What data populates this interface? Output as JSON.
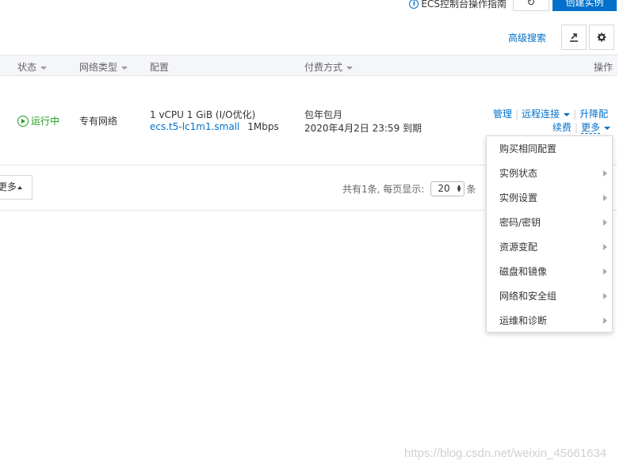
{
  "toolbar": {
    "guide_label": "ECS控制台操作指南",
    "create_label": "创建实例",
    "advanced_search": "高级搜索"
  },
  "table": {
    "headers": {
      "status": "状态",
      "network": "网络类型",
      "config": "配置",
      "billing": "付费方式",
      "actions": "操作"
    },
    "row": {
      "status": "运行中",
      "network": "专有网络",
      "config_line1": "1 vCPU 1 GiB (I/O优化)",
      "instance_type": "ecs.t5-lc1m1.small",
      "bandwidth": "1Mbps",
      "billing_line1": "包年包月",
      "billing_line2": "2020年4月2日 23:59 到期",
      "actions": {
        "manage": "管理",
        "remote": "远程连接",
        "upgrade": "升降配",
        "renew": "续费",
        "more": "更多"
      }
    }
  },
  "footer": {
    "more_button": "更多",
    "total_text": "共有1条, 每页显示:",
    "page_size": "20",
    "unit": "条"
  },
  "dropdown": {
    "items": [
      {
        "label": "购买相同配置",
        "submenu": false
      },
      {
        "label": "实例状态",
        "submenu": true
      },
      {
        "label": "实例设置",
        "submenu": true
      },
      {
        "label": "密码/密钥",
        "submenu": true
      },
      {
        "label": "资源变配",
        "submenu": true
      },
      {
        "label": "磁盘和镜像",
        "submenu": true
      },
      {
        "label": "网络和安全组",
        "submenu": true
      },
      {
        "label": "运维和诊断",
        "submenu": true
      }
    ]
  },
  "watermark": "https://blog.csdn.net/weixin_45661634",
  "colors": {
    "primary": "#0070cc",
    "running": "#1e9c1e",
    "header_bg": "#f5f6fa"
  }
}
